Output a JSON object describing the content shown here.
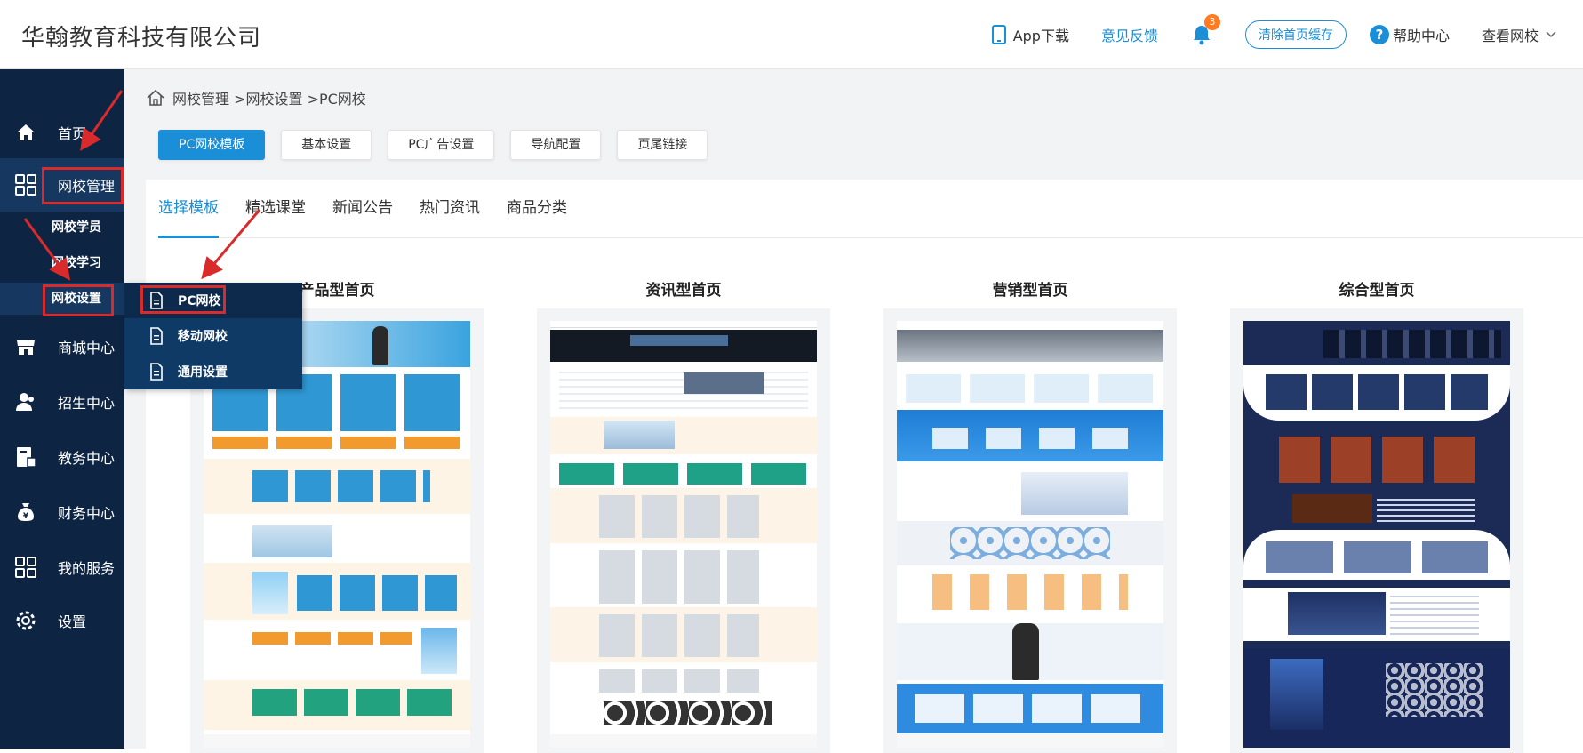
{
  "header": {
    "company": "华翰教育科技有限公司",
    "app_download": "App下载",
    "feedback": "意见反馈",
    "notification_count": "3",
    "clear_cache": "清除首页缓存",
    "help_center": "帮助中心",
    "view_school": "查看网校"
  },
  "sidebar": {
    "items": [
      {
        "label": "首页",
        "icon": "home-icon"
      },
      {
        "label": "网校管理",
        "icon": "grid-icon"
      },
      {
        "label": "商城中心",
        "icon": "store-icon"
      },
      {
        "label": "招生中心",
        "icon": "users-icon"
      },
      {
        "label": "教务中心",
        "icon": "book-icon"
      },
      {
        "label": "财务中心",
        "icon": "money-bag-icon"
      },
      {
        "label": "我的服务",
        "icon": "grid-icon"
      },
      {
        "label": "设置",
        "icon": "gear-icon"
      }
    ],
    "subitems": [
      {
        "label": "网校学员"
      },
      {
        "label": "网校学习"
      },
      {
        "label": "网校设置"
      }
    ]
  },
  "flyout": {
    "items": [
      {
        "label": "PC网校",
        "icon": "document-icon"
      },
      {
        "label": "移动网校",
        "icon": "document-icon"
      },
      {
        "label": "通用设置",
        "icon": "document-icon"
      }
    ]
  },
  "breadcrumb": {
    "text": "网校管理 >网校设置 >PC网校"
  },
  "toolbar": {
    "buttons": [
      "PC网校模板",
      "基本设置",
      "PC广告设置",
      "导航配置",
      "页尾链接"
    ],
    "active": "PC网校模板"
  },
  "tabs": {
    "items": [
      "选择模板",
      "精选课堂",
      "新闻公告",
      "热门资讯",
      "商品分类"
    ],
    "active": "选择模板"
  },
  "templates": [
    {
      "title": "产品型首页"
    },
    {
      "title": "资讯型首页"
    },
    {
      "title": "营销型首页"
    },
    {
      "title": "综合型首页"
    }
  ],
  "colors": {
    "sidebar_bg": "#0d2443",
    "accent": "#1a8fd8",
    "highlight_box": "#d92b2b",
    "badge": "#ff7a21"
  }
}
